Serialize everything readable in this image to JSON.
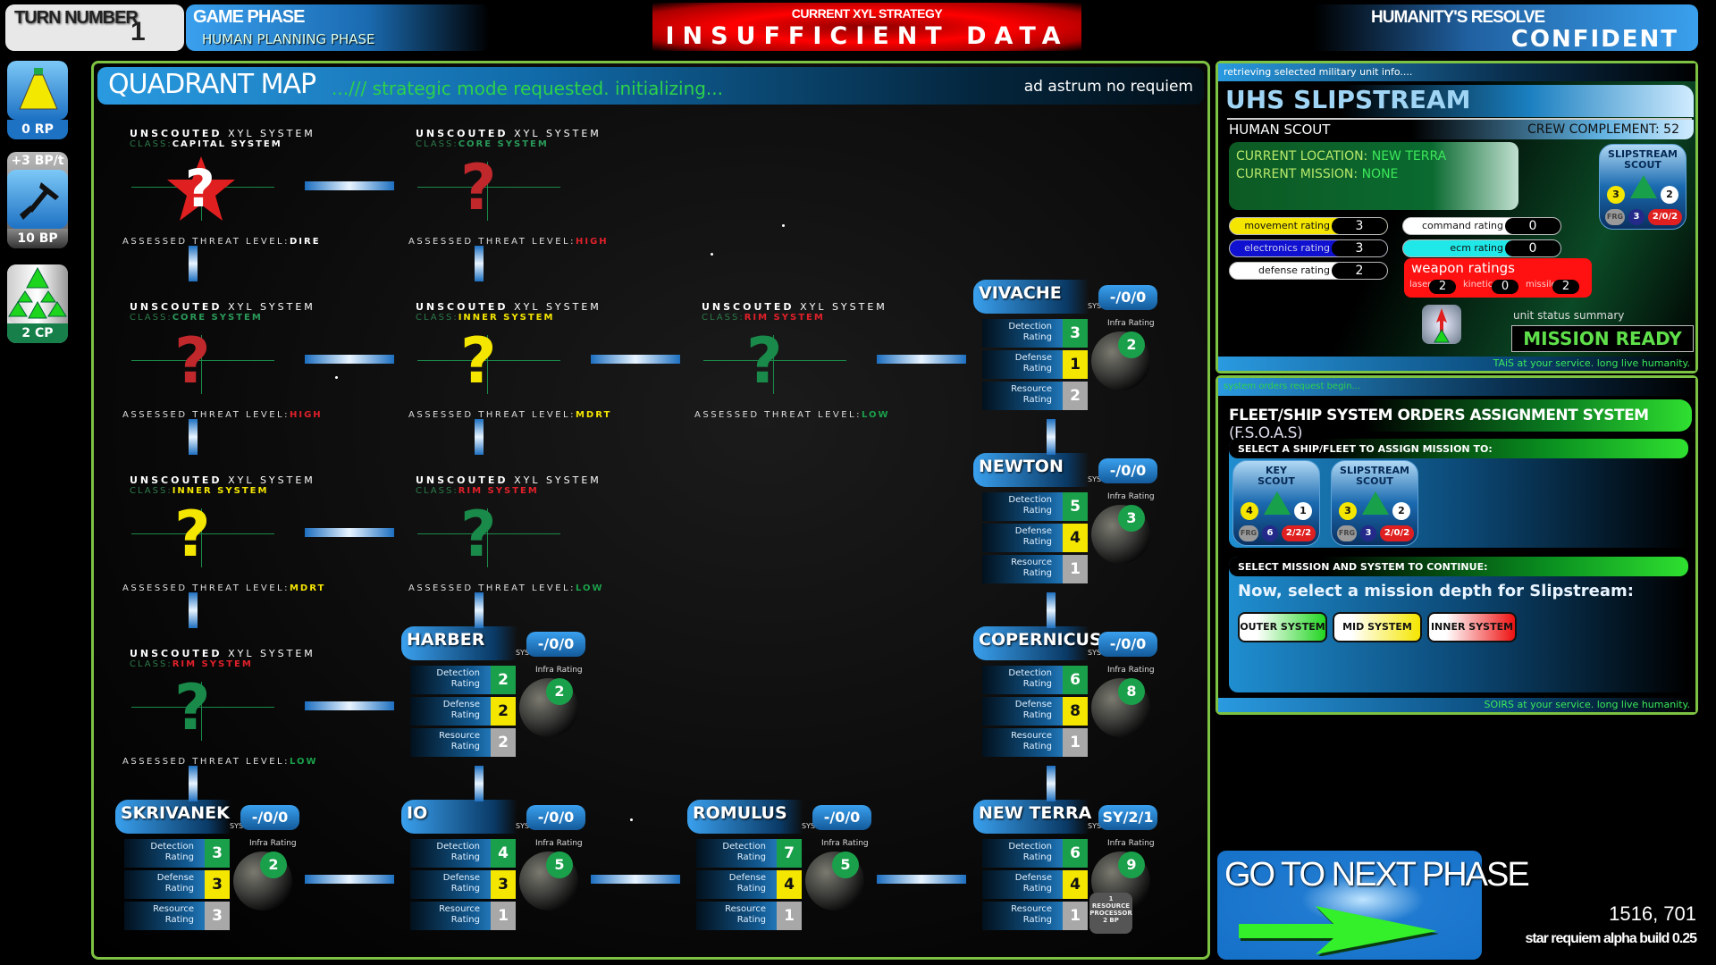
{
  "topbar": {
    "turn_label": "TURN NUMBER",
    "turn_value": "1",
    "phase_label": "GAME PHASE",
    "phase_value": "HUMAN PLANNING PHASE",
    "strategy_label": "CURRENT XYL STRATEGY",
    "strategy_value": "INSUFFICIENT DATA",
    "resolve_label": "HUMANITY'S RESOLVE",
    "resolve_value": "CONFIDENT"
  },
  "resources": {
    "research": {
      "icon": "flask-icon",
      "value": "0 RP"
    },
    "build_rate": "+3 BP/t",
    "build": {
      "icon": "hammer-icon",
      "value": "10 BP"
    },
    "command": {
      "icon": "fleet-triangles-icon",
      "value": "2 CP"
    }
  },
  "map": {
    "title": "QUADRANT MAP",
    "subtitle": "...///  strategic mode requested. initializing...",
    "motto": "ad astrum no requiem",
    "unscouted": [
      {
        "l1a": "UNSCOUTED",
        "l1b": " XYL SYSTEM",
        "class_label": "CLASS:",
        "class": "CAPITAL SYSTEM",
        "class_color": "#ffffff",
        "glyph": "star",
        "glyph_color": "#ffffff",
        "threat_label": "ASSESSED THREAT LEVEL:",
        "threat": "DIRE",
        "threat_color": "#ffffff"
      },
      {
        "l1a": "UNSCOUTED",
        "l1b": " XYL SYSTEM",
        "class_label": "CLASS:",
        "class": "CORE SYSTEM",
        "class_color": "#2a9a5a",
        "glyph": "?",
        "glyph_color": "#c0282c",
        "threat_label": "ASSESSED THREAT LEVEL:",
        "threat": "HIGH",
        "threat_color": "#e0202a"
      },
      {
        "l1a": "UNSCOUTED",
        "l1b": " XYL SYSTEM",
        "class_label": "CLASS:",
        "class": "CORE SYSTEM",
        "class_color": "#2a9a5a",
        "glyph": "?",
        "glyph_color": "#c0282c",
        "threat_label": "ASSESSED THREAT LEVEL:",
        "threat": "HIGH",
        "threat_color": "#e0202a"
      },
      {
        "l1a": "UNSCOUTED",
        "l1b": " XYL SYSTEM",
        "class_label": "CLASS:",
        "class": "INNER SYSTEM",
        "class_color": "#f5e600",
        "glyph": "?",
        "glyph_color": "#f5e600",
        "threat_label": "ASSESSED THREAT LEVEL:",
        "threat": "MDRT",
        "threat_color": "#f5e600"
      },
      {
        "l1a": "UNSCOUTED",
        "l1b": " XYL SYSTEM",
        "class_label": "CLASS:",
        "class": "RIM SYSTEM",
        "class_color": "#e0202a",
        "glyph": "?",
        "glyph_color": "#1a8a4a",
        "threat_label": "ASSESSED THREAT LEVEL:",
        "threat": "LOW",
        "threat_color": "#1aa04a"
      },
      {
        "l1a": "UNSCOUTED",
        "l1b": " XYL SYSTEM",
        "class_label": "CLASS:",
        "class": "INNER SYSTEM",
        "class_color": "#f5e600",
        "glyph": "?",
        "glyph_color": "#f5e600",
        "threat_label": "ASSESSED THREAT LEVEL:",
        "threat": "MDRT",
        "threat_color": "#f5e600"
      },
      {
        "l1a": "UNSCOUTED",
        "l1b": " XYL SYSTEM",
        "class_label": "CLASS:",
        "class": "RIM SYSTEM",
        "class_color": "#e0202a",
        "glyph": "?",
        "glyph_color": "#1a8a4a",
        "threat_label": "ASSESSED THREAT LEVEL:",
        "threat": "LOW",
        "threat_color": "#1aa04a"
      },
      {
        "l1a": "UNSCOUTED",
        "l1b": " XYL SYSTEM",
        "class_label": "CLASS:",
        "class": "RIM SYSTEM",
        "class_color": "#e0202a",
        "glyph": "?",
        "glyph_color": "#1a8a4a",
        "threat_label": "ASSESSED THREAT LEVEL:",
        "threat": "LOW",
        "threat_color": "#1aa04a"
      }
    ],
    "systems": [
      {
        "name": "VIVACHE",
        "tag": "SYSTEM",
        "code": "-/0/0",
        "detection": "3",
        "defense": "1",
        "resource": "2",
        "infra": "2"
      },
      {
        "name": "NEWTON",
        "tag": "SYSTEM",
        "code": "-/0/0",
        "detection": "5",
        "defense": "4",
        "resource": "1",
        "infra": "3"
      },
      {
        "name": "HARBER",
        "tag": "SYSTEM",
        "code": "-/0/0",
        "detection": "2",
        "defense": "2",
        "resource": "2",
        "infra": "2"
      },
      {
        "name": "COPERNICUS",
        "tag": "SYSTEM",
        "code": "-/0/0",
        "detection": "6",
        "defense": "8",
        "resource": "1",
        "infra": "8"
      },
      {
        "name": "SKRIVANEK",
        "tag": "SYSTEM",
        "code": "-/0/0",
        "detection": "3",
        "defense": "3",
        "resource": "3",
        "infra": "2"
      },
      {
        "name": "IO",
        "tag": "SYSTEM",
        "code": "-/0/0",
        "detection": "4",
        "defense": "3",
        "resource": "1",
        "infra": "5"
      },
      {
        "name": "ROMULUS",
        "tag": "SYSTEM",
        "code": "-/0/0",
        "detection": "7",
        "defense": "4",
        "resource": "1",
        "infra": "5"
      },
      {
        "name": "NEW TERRA",
        "tag": "SYSTEM",
        "code": "SY/2/1",
        "detection": "6",
        "defense": "4",
        "resource": "1",
        "infra": "9",
        "processor": {
          "count": "1",
          "label1": "RESOURCE",
          "label2": "PROCESSOR",
          "cost": "2 BP"
        }
      }
    ],
    "rating_labels": {
      "detection": [
        "Detection",
        "Rating"
      ],
      "defense": [
        "Defense",
        "Rating"
      ],
      "resource": [
        "Resource",
        "Rating"
      ],
      "infra": "Infra Rating"
    }
  },
  "unit": {
    "header": "retrieving selected military unit info....",
    "name": "UHS SLIPSTREAM",
    "type": "HUMAN SCOUT",
    "crew": "CREW COMPLEMENT: 52",
    "location_label": "CURRENT LOCATION: ",
    "location": "NEW TERRA",
    "mission_label": "CURRENT MISSION: ",
    "mission": "NONE",
    "ratings": [
      {
        "label": "movement rating",
        "value": "3",
        "color": "#f5e600"
      },
      {
        "label": "electronics rating",
        "value": "3",
        "color": "#1010d0"
      },
      {
        "label": "defense rating",
        "value": "2",
        "color": "#ffffff"
      },
      {
        "label": "command rating",
        "value": "0",
        "color": "#ffffff"
      },
      {
        "label": "ecm rating",
        "value": "0",
        "color": "#20e8e8"
      }
    ],
    "weapons_label": "weapon ratings",
    "weapons": [
      {
        "label": "laser",
        "value": "2"
      },
      {
        "label": "kinetic",
        "value": "0"
      },
      {
        "label": "missile",
        "value": "2"
      }
    ],
    "status_label": "unit status summary",
    "status": "MISSION READY",
    "footer": "TAiS at your service. long live humanity."
  },
  "ship_cards": [
    {
      "name1": "KEY",
      "name2": "SCOUT",
      "move": "4",
      "cmd": "1",
      "cls": "FRG",
      "hull": "6",
      "weap": "2/2/2"
    },
    {
      "name1": "SLIPSTREAM",
      "name2": "SCOUT",
      "move": "3",
      "cmd": "2",
      "cls": "FRG",
      "hull": "3",
      "weap": "2/0/2"
    }
  ],
  "orders": {
    "header": "system orders request begin...",
    "title": "FLEET/SHIP SYSTEM ORDERS ASSIGNMENT SYSTEM ",
    "title_abbr": "(F.S.O.A.S)",
    "select_ship": "SELECT A SHIP/FLEET TO ASSIGN MISSION TO:",
    "select_mission": "SELECT MISSION AND SYSTEM TO CONTINUE:",
    "prompt": "Now, select a mission depth for Slipstream:",
    "depths": [
      {
        "label": "OUTER SYSTEM",
        "color": "#22d522"
      },
      {
        "label": "MID SYSTEM",
        "color": "#f5e600"
      },
      {
        "label": "INNER SYSTEM",
        "color": "#ee1111"
      }
    ],
    "footer": "SOIRS at your service. long live humanity."
  },
  "next_phase": {
    "label": "GO TO NEXT PHASE"
  },
  "cursor_coords": "1516, 701",
  "build_info": "star requiem alpha build 0.25"
}
